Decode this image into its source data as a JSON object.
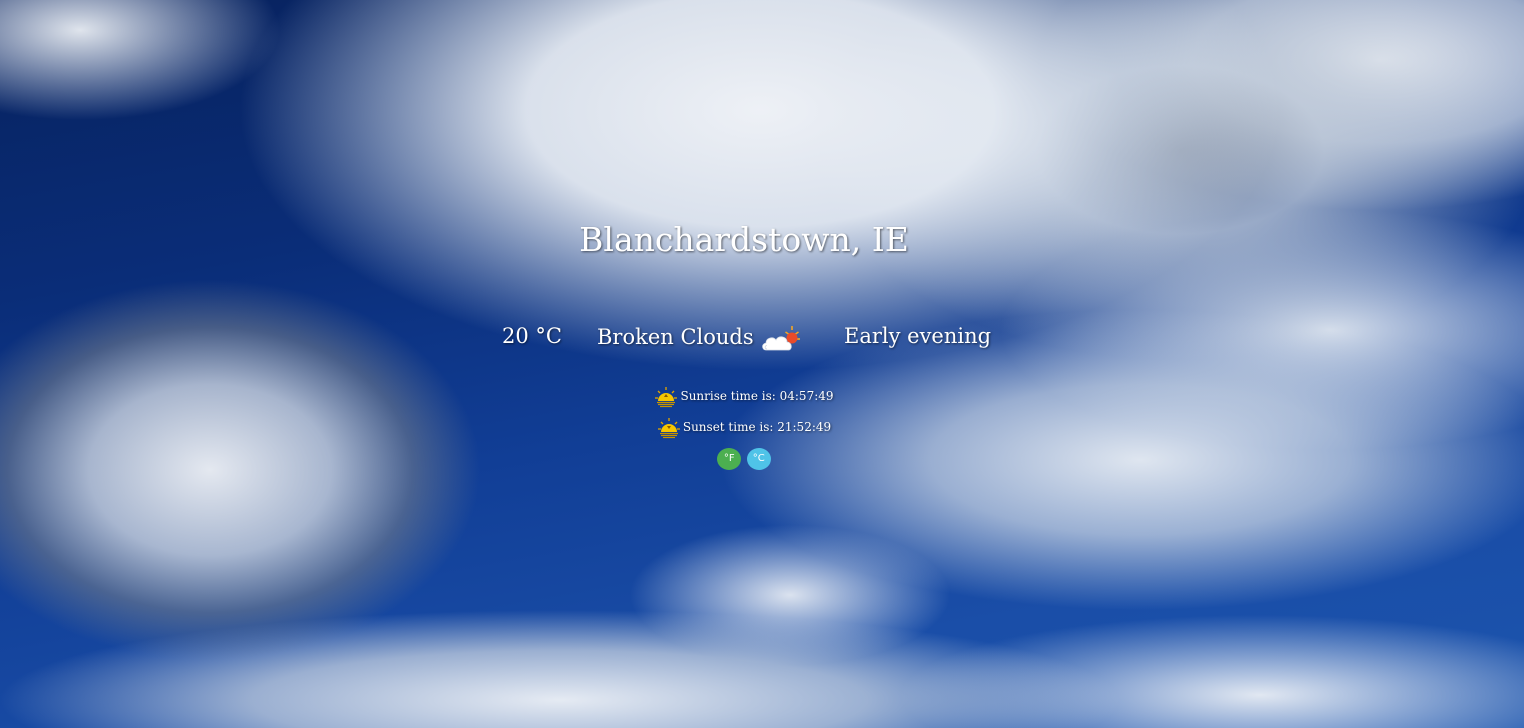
{
  "location": {
    "city_label": "Blanchardstown, IE"
  },
  "weather": {
    "temperature": "20 °C",
    "description": "Broken Clouds",
    "icon": "cloud-sun-icon",
    "time_of_day": "Early evening"
  },
  "sun": {
    "sunrise_text": "Sunrise time is: 04:57:49",
    "sunset_text": "Sunset time is: 21:52:49",
    "sunrise_icon": "sunrise-icon",
    "sunset_icon": "sunset-icon"
  },
  "units": {
    "fahrenheit_label": "°F",
    "celsius_label": "°C",
    "fahrenheit_color": "#4caf50",
    "celsius_color": "#4fc3e8"
  },
  "colors": {
    "sky_dark": "#07225e",
    "sky_light": "#1c55ae",
    "text": "#ffffff"
  }
}
